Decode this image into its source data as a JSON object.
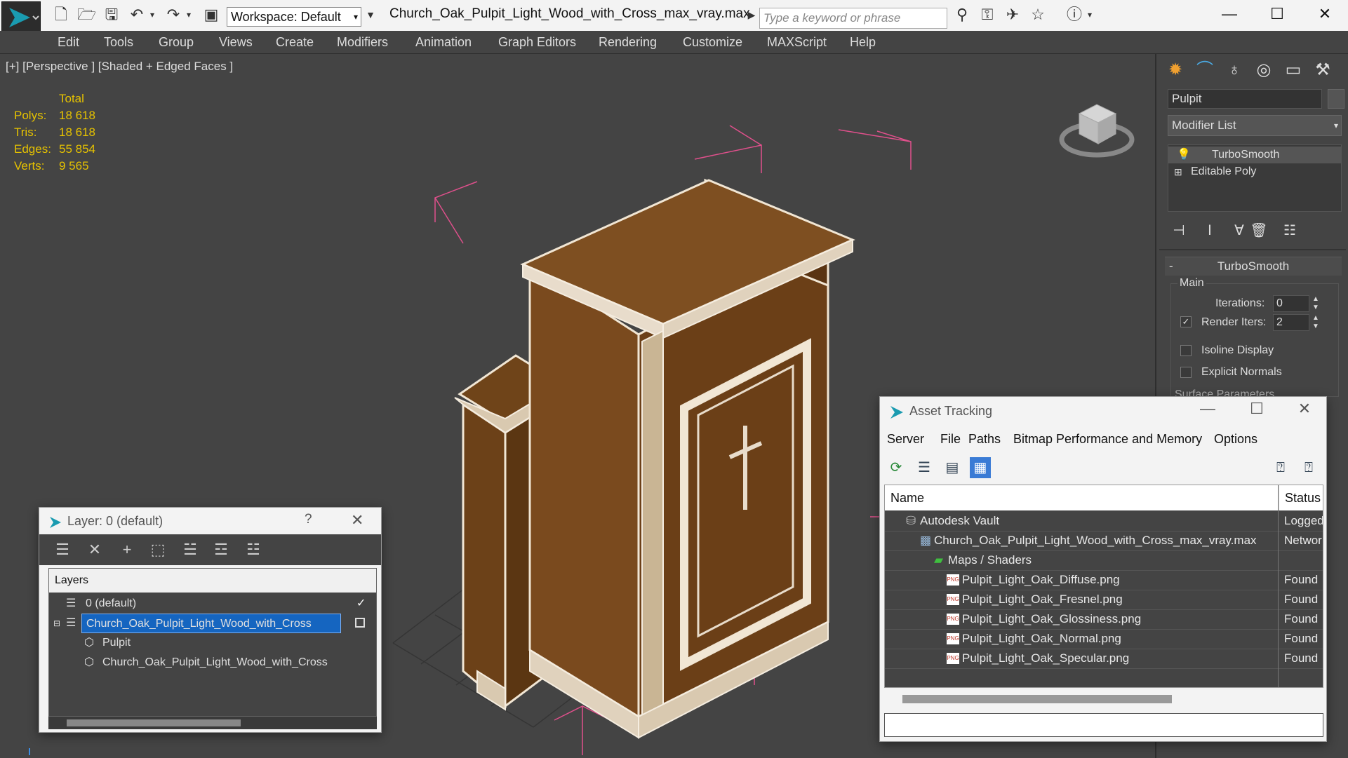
{
  "window": {
    "title": "Church_Oak_Pulpit_Light_Wood_with_Cross_max_vray.max",
    "workspace": "Workspace: Default",
    "search_placeholder": "Type a keyword or phrase"
  },
  "menu": [
    "Edit",
    "Tools",
    "Group",
    "Views",
    "Create",
    "Modifiers",
    "Animation",
    "Graph Editors",
    "Rendering",
    "Customize",
    "MAXScript",
    "Help"
  ],
  "viewport": {
    "label": "[+] [Perspective ] [Shaded + Edged Faces ]",
    "stats": {
      "header": "Total",
      "rows": [
        {
          "label": "Polys:",
          "value": "18 618"
        },
        {
          "label": "Tris:",
          "value": "18 618"
        },
        {
          "label": "Edges:",
          "value": "55 854"
        },
        {
          "label": "Verts:",
          "value": "9 565"
        }
      ]
    }
  },
  "command_panel": {
    "object_name": "Pulpit",
    "modifier_list": "Modifier List",
    "stack": [
      "TurboSmooth",
      "Editable Poly"
    ],
    "rollout_title": "TurboSmooth",
    "group_main": "Main",
    "iterations_label": "Iterations:",
    "iterations_value": "0",
    "render_iters_label": "Render Iters:",
    "render_iters_value": "2",
    "isoline_label": "Isoline Display",
    "explicit_normals_label": "Explicit Normals",
    "surface_params": "Surface Parameters"
  },
  "layer_window": {
    "title": "Layer: 0 (default)",
    "help": "?",
    "header": "Layers",
    "rows": [
      {
        "name": "0 (default)"
      },
      {
        "name": "Church_Oak_Pulpit_Light_Wood_with_Cross"
      },
      {
        "name": "Pulpit"
      },
      {
        "name": "Church_Oak_Pulpit_Light_Wood_with_Cross"
      }
    ]
  },
  "asset_window": {
    "title": "Asset Tracking",
    "menu": [
      "Server",
      "File",
      "Paths",
      "Bitmap Performance and Memory",
      "Options"
    ],
    "columns": {
      "name": "Name",
      "status": "Status"
    },
    "rows": [
      {
        "name": "Autodesk Vault",
        "status": "Logged"
      },
      {
        "name": "Church_Oak_Pulpit_Light_Wood_with_Cross_max_vray.max",
        "status": "Network"
      },
      {
        "name": "Maps / Shaders",
        "status": ""
      },
      {
        "name": "Pulpit_Light_Oak_Diffuse.png",
        "status": "Found"
      },
      {
        "name": "Pulpit_Light_Oak_Fresnel.png",
        "status": "Found"
      },
      {
        "name": "Pulpit_Light_Oak_Glossiness.png",
        "status": "Found"
      },
      {
        "name": "Pulpit_Light_Oak_Normal.png",
        "status": "Found"
      },
      {
        "name": "Pulpit_Light_Oak_Specular.png",
        "status": "Found"
      }
    ]
  },
  "colors": {
    "ui_dark": "#444444",
    "stats_yellow": "#e6c200",
    "selection_blue": "#1565c0",
    "wood": "#7a4a1e",
    "bbox_pink": "#e0508c"
  }
}
